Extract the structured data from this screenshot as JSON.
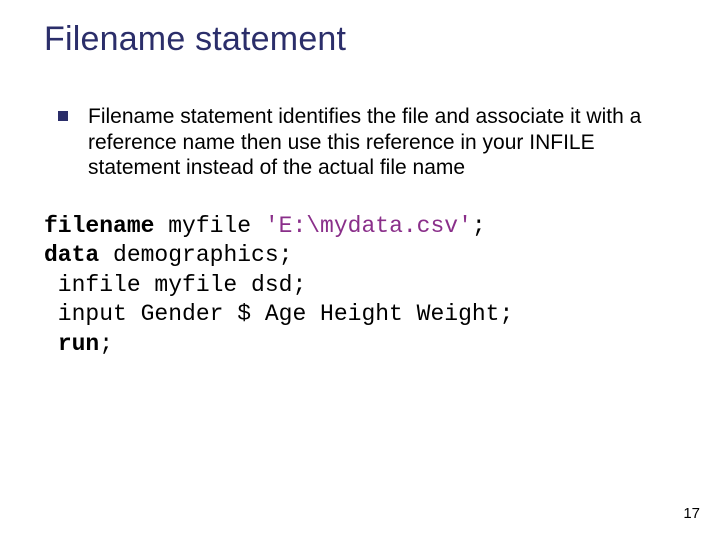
{
  "title": "Filename statement",
  "bullet": {
    "text": "Filename statement identifies the file and associate it with a reference name then use this reference in your INFILE statement instead of the actual file name"
  },
  "code": {
    "kw_filename": "filename",
    "myfile": " myfile ",
    "path": "'E:\\mydata.csv'",
    "semi1": ";",
    "kw_data": "data",
    "data_rest": " demographics;",
    "infile_line": " infile myfile dsd;",
    "input_line": " input Gender $ Age Height Weight;",
    "sp_run": " ",
    "kw_run": "run",
    "semi_run": ";"
  },
  "page_number": "17"
}
